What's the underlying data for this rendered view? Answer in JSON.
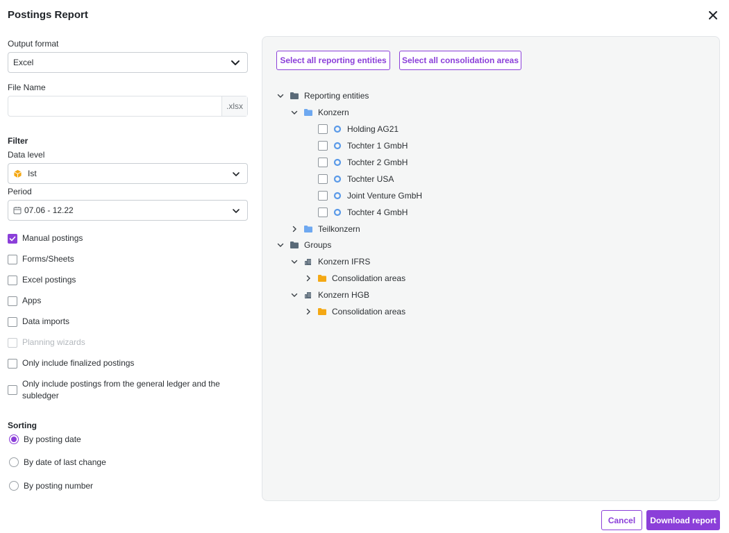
{
  "dialog": {
    "title": "Postings Report"
  },
  "output_format": {
    "label": "Output format",
    "value": "Excel"
  },
  "file_name": {
    "label": "File Name",
    "value": "",
    "extension": ".xlsx"
  },
  "filter": {
    "heading": "Filter",
    "data_level_label": "Data level",
    "data_level_value": "Ist",
    "period_label": "Period",
    "period_value": "07.06 - 12.22"
  },
  "postings": [
    {
      "label": "Manual postings",
      "checked": true,
      "disabled": false
    },
    {
      "label": "Forms/Sheets",
      "checked": false,
      "disabled": false
    },
    {
      "label": "Excel postings",
      "checked": false,
      "disabled": false
    },
    {
      "label": "Apps",
      "checked": false,
      "disabled": false
    },
    {
      "label": "Data imports",
      "checked": false,
      "disabled": false
    },
    {
      "label": "Planning wizards",
      "checked": false,
      "disabled": true
    },
    {
      "label": "Only include finalized postings",
      "checked": false,
      "disabled": false
    },
    {
      "label": "Only include postings from the general ledger and the subledger",
      "checked": false,
      "disabled": false
    }
  ],
  "sorting": {
    "heading": "Sorting",
    "options": [
      {
        "label": "By posting date",
        "selected": true
      },
      {
        "label": "By date of last change",
        "selected": false
      },
      {
        "label": "By posting number",
        "selected": false
      }
    ]
  },
  "tree": {
    "select_all_entities": "Select all reporting entities",
    "select_all_areas": "Select all consolidation areas",
    "reporting_entities": "Reporting entities",
    "konzern": "Konzern",
    "entities": [
      "Holding AG21",
      "Tochter 1 GmbH",
      "Tochter 2 GmbH",
      "Tochter USA",
      "Joint Venture GmbH",
      "Tochter 4 GmbH"
    ],
    "teilkonzern": "Teilkonzern",
    "groups": "Groups",
    "konzern_ifrs": "Konzern IFRS",
    "konzern_hgb": "Konzern HGB",
    "consolidation_areas": "Consolidation areas"
  },
  "footer": {
    "cancel": "Cancel",
    "download": "Download report"
  },
  "colors": {
    "accent": "#8b3fd9",
    "panel_bg": "#f5f6f6",
    "folder_dark": "#5a6a78",
    "folder_blue": "#6ea8f0",
    "folder_orange": "#f4a814",
    "entity_ring": "#5b9ae8"
  }
}
